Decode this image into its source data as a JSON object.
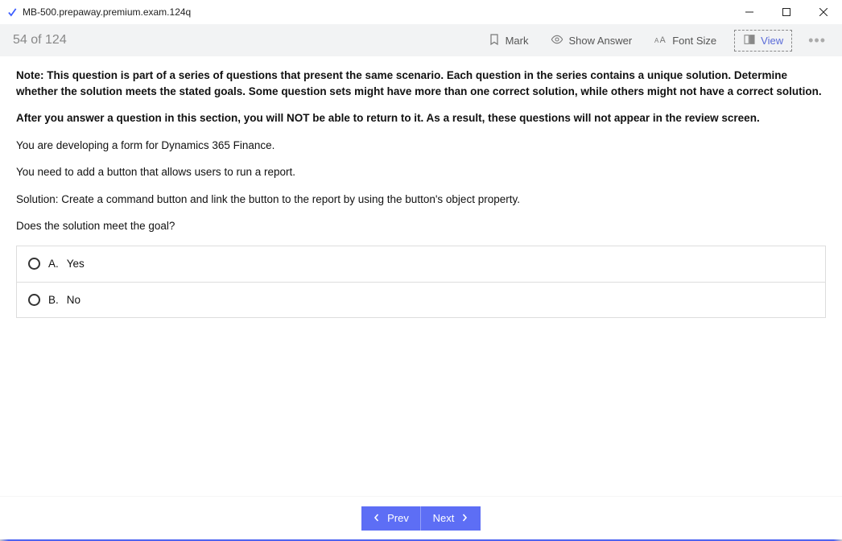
{
  "window": {
    "title": "MB-500.prepaway.premium.exam.124q"
  },
  "toolbar": {
    "progress": "54 of 124",
    "mark": "Mark",
    "show_answer": "Show Answer",
    "font_size": "Font Size",
    "view": "View"
  },
  "question": {
    "note": "Note: This question is part of a series of questions that present the same scenario. Each question in the series contains a unique solution. Determine whether the solution meets the stated goals. Some question sets might have more than one correct solution, while others might not have a correct solution.",
    "warning": "After you answer a question in this section, you will NOT be able to return to it. As a result, these questions will not appear in the review screen.",
    "line1": "You are developing a form for Dynamics 365 Finance.",
    "line2": "You need to add a button that allows users to run a report.",
    "line3": "Solution: Create a command button and link the button to the report by using the button's object property.",
    "line4": "Does the solution meet the goal?",
    "options": [
      {
        "letter": "A.",
        "text": "Yes"
      },
      {
        "letter": "B.",
        "text": "No"
      }
    ]
  },
  "footer": {
    "prev": "Prev",
    "next": "Next"
  }
}
